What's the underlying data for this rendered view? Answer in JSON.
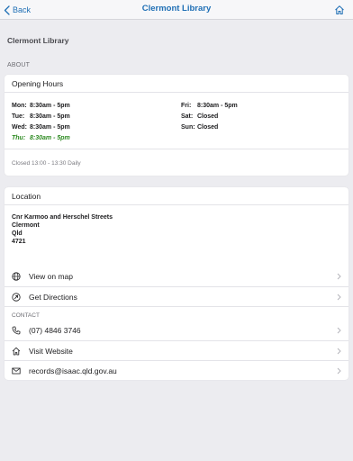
{
  "nav": {
    "back_label": "Back",
    "title": "Clermont Library",
    "home_icon": "home-icon",
    "back_icon": "chevron-left-icon"
  },
  "page_title": "Clermont Library",
  "about_header": "ABOUT",
  "opening_hours": {
    "title": "Opening Hours",
    "days": [
      {
        "day": "Mon:",
        "hours": "8:30am - 5pm"
      },
      {
        "day": "Tue:",
        "hours": "8:30am - 5pm"
      },
      {
        "day": "Wed:",
        "hours": "8:30am - 5pm"
      },
      {
        "day": "Thu:",
        "hours": "8:30am - 5pm"
      },
      {
        "day": "Fri:",
        "hours": "8:30am - 5pm"
      },
      {
        "day": "Sat:",
        "hours": "Closed"
      },
      {
        "day": "Sun:",
        "hours": "Closed"
      }
    ],
    "note": "Closed 13:00 - 13:30 Daily"
  },
  "location": {
    "title": "Location",
    "address_lines": [
      "Cnr Karmoo and Herschel Streets",
      "Clermont",
      "Qld",
      "4721"
    ],
    "view_map_label": "View on map",
    "directions_label": "Get Directions"
  },
  "contact": {
    "header": "CONTACT",
    "phone": "(07) 4846 3746",
    "website_label": "Visit Website",
    "email": "records@isaac.qld.gov.au"
  },
  "colors": {
    "accent": "#1f6fb5",
    "today": "#2e8b22",
    "background": "#ececf0"
  }
}
